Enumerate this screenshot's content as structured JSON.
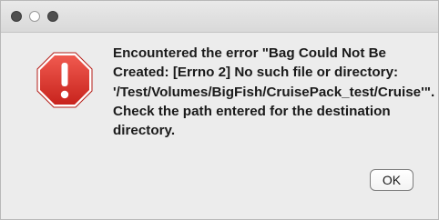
{
  "window": {
    "traffic_lights": [
      "close",
      "minimize",
      "zoom"
    ]
  },
  "dialog": {
    "icon": "stop-alert-icon",
    "icon_color": "#d9302a",
    "message": "Encountered the error \"Bag Could Not Be Created: [Errno 2] No such file or directory: '/Test/Volumes/BigFish/CruisePack_test/Cruise'\". Check the path entered for the destination directory.",
    "ok_label": "OK"
  }
}
